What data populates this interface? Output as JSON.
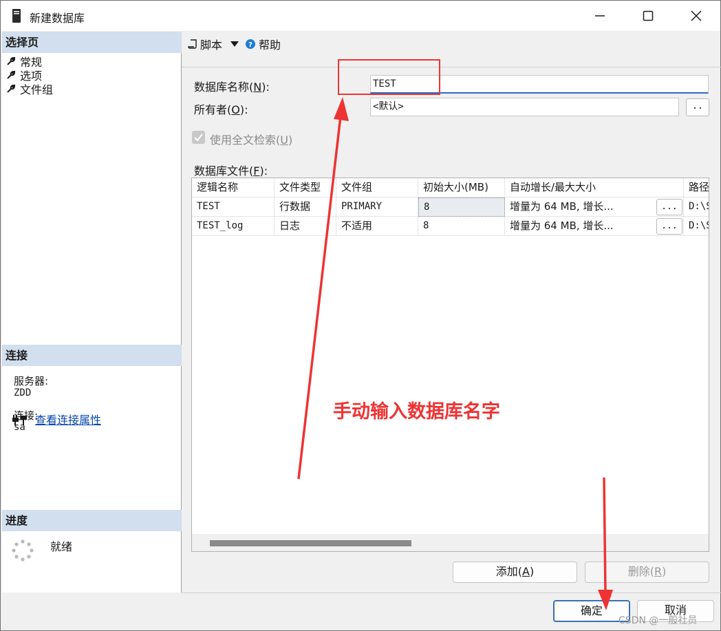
{
  "window": {
    "title": "新建数据库"
  },
  "left_panel": {
    "select_page_header": "选择页",
    "pages": [
      {
        "label": "常规"
      },
      {
        "label": "选项"
      },
      {
        "label": "文件组"
      }
    ],
    "connection_header": "连接",
    "server_label": "服务器:",
    "server_value": "ZDD",
    "connection_label": "连接:",
    "connection_value": "sa",
    "view_properties_link": "查看连接属性",
    "progress_header": "进度",
    "progress_status": "就绪"
  },
  "toolbar": {
    "script_label": "脚本",
    "help_label": "帮助"
  },
  "form": {
    "db_name_label_pre": "数据库名称(",
    "db_name_label_key": "N",
    "db_name_label_post": "):",
    "db_name_value": "TEST",
    "owner_label_pre": "所有者(",
    "owner_label_key": "O",
    "owner_label_post": "):",
    "owner_value": "<默认>",
    "owner_browse": "..",
    "fulltext_label_pre": "使用全文检索(",
    "fulltext_label_key": "U",
    "fulltext_label_post": ")",
    "db_files_label_pre": "数据库文件(",
    "db_files_label_key": "F",
    "db_files_label_post": "):"
  },
  "grid": {
    "columns": [
      "逻辑名称",
      "文件类型",
      "文件组",
      "初始大小(MB)",
      "自动增长/最大大小",
      "路径"
    ],
    "rows": [
      {
        "logical": "TEST",
        "type": "行数据",
        "group": "PRIMARY",
        "size": "8",
        "growth": "增量为 64 MB, 增长...",
        "btn": "...",
        "path": "D:\\S"
      },
      {
        "logical": "TEST_log",
        "type": "日志",
        "group": "不适用",
        "size": "8",
        "growth": "增量为 64 MB, 增长...",
        "btn": "...",
        "path": "D:\\S"
      }
    ]
  },
  "buttons": {
    "add_pre": "添加(",
    "add_key": "A",
    "add_post": ")",
    "remove_pre": "删除(",
    "remove_key": "R",
    "remove_post": ")",
    "ok": "确定",
    "cancel": "取消"
  },
  "annotation": {
    "text": "手动输入数据库名字",
    "color": "#ee3333"
  },
  "watermark": "CSDN @一般社员",
  "colors": {
    "section_header_bg": "#d1dfee",
    "link": "#0645ad",
    "focus": "#2a6acb"
  }
}
